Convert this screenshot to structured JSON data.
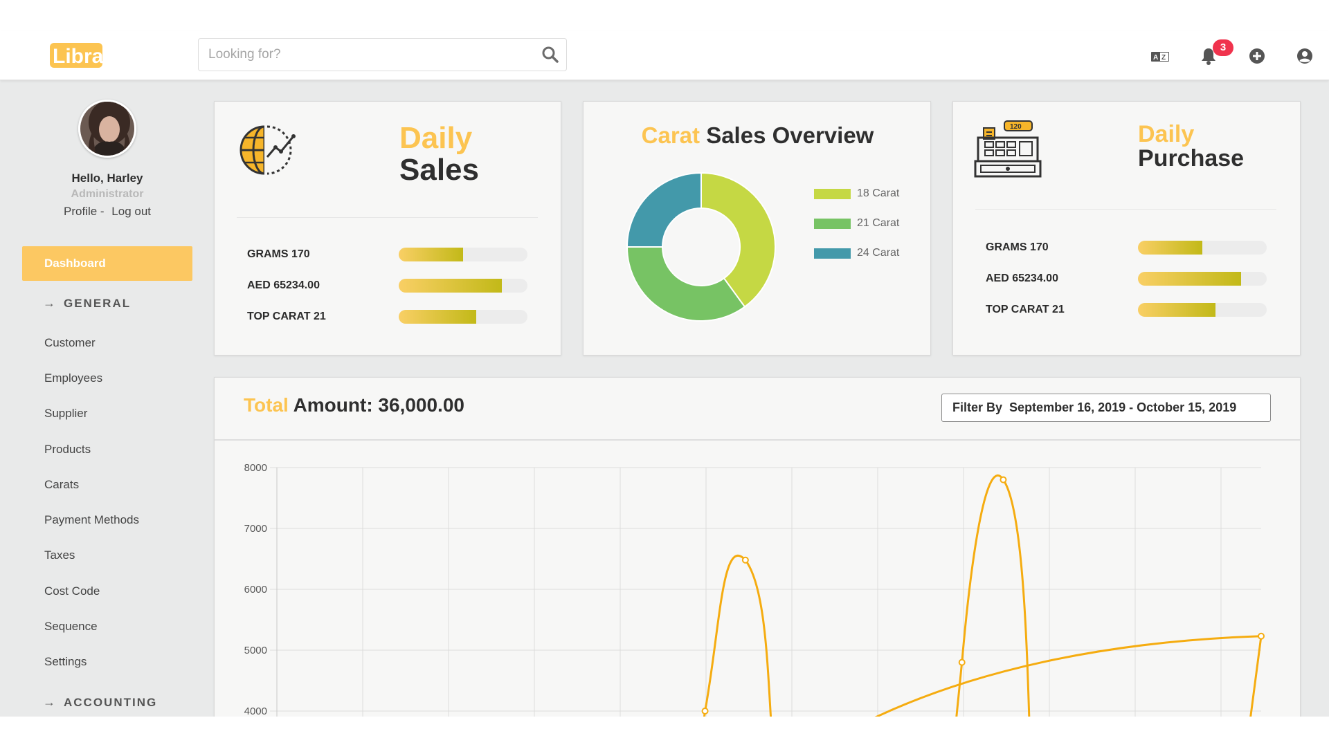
{
  "app": {
    "logo_text": "Libra"
  },
  "header": {
    "search_placeholder": "Looking for?",
    "notifications_count": "3",
    "icons": [
      "search-icon",
      "translate-icon",
      "bell-icon",
      "plus-circle-icon",
      "user-circle-icon"
    ]
  },
  "sidebar": {
    "greeting": "Hello, Harley",
    "role": "Administrator",
    "profile_link": "Profile",
    "separator": " - ",
    "logout_link": "Log out",
    "active_item": "Dashboard",
    "section_general": "GENERAL",
    "items": [
      "Customer",
      "Employees",
      "Supplier",
      "Products",
      "Carats",
      "Payment Methods",
      "Taxes",
      "Cost Code",
      "Sequence",
      "Settings"
    ],
    "section_accounting": "ACCOUNTING"
  },
  "daily_sales": {
    "title_highlight": "Daily",
    "title_rest": "Sales",
    "metrics": [
      {
        "label": "GRAMS 170",
        "fill": 0.5
      },
      {
        "label": "AED 65234.00",
        "fill": 0.8
      },
      {
        "label": "TOP CARAT 21",
        "fill": 0.6
      }
    ]
  },
  "carat_overview": {
    "title_highlight": "Carat",
    "title_rest": "Sales Overview",
    "legend": [
      {
        "label": "18 Carat",
        "color": "#c5d844"
      },
      {
        "label": "21 Carat",
        "color": "#77c364"
      },
      {
        "label": "24 Carat",
        "color": "#4399aa"
      }
    ]
  },
  "daily_purchase": {
    "title_highlight": "Daily",
    "title_rest": "Purchase",
    "metrics": [
      {
        "label": "GRAMS 170",
        "fill": 0.5
      },
      {
        "label": "AED 65234.00",
        "fill": 0.8
      },
      {
        "label": "TOP CARAT 21",
        "fill": 0.6
      }
    ]
  },
  "total": {
    "title_highlight": "Total",
    "title_rest": "Amount: 36,000.00",
    "filter_label": "Filter By",
    "filter_range": "September 16, 2019 - October 15, 2019"
  },
  "chart_data": [
    {
      "type": "pie",
      "donut": true,
      "categories": [
        "18 Carat",
        "21 Carat",
        "24 Carat"
      ],
      "values": [
        40,
        35,
        25
      ],
      "colors": [
        "#c5d844",
        "#77c364",
        "#4399aa"
      ]
    },
    {
      "type": "line",
      "y_ticks": [
        8000,
        7000,
        6000,
        5000,
        4000
      ],
      "ylim": [
        4000,
        8000
      ],
      "grid": true,
      "color": "#f5ac10",
      "series": [
        {
          "points": [
            [
              0.435,
              4000
            ],
            [
              0.476,
              6480
            ],
            [
              0.696,
              4800
            ],
            [
              0.738,
              7800
            ],
            [
              1.0,
              5230
            ]
          ]
        }
      ]
    }
  ]
}
